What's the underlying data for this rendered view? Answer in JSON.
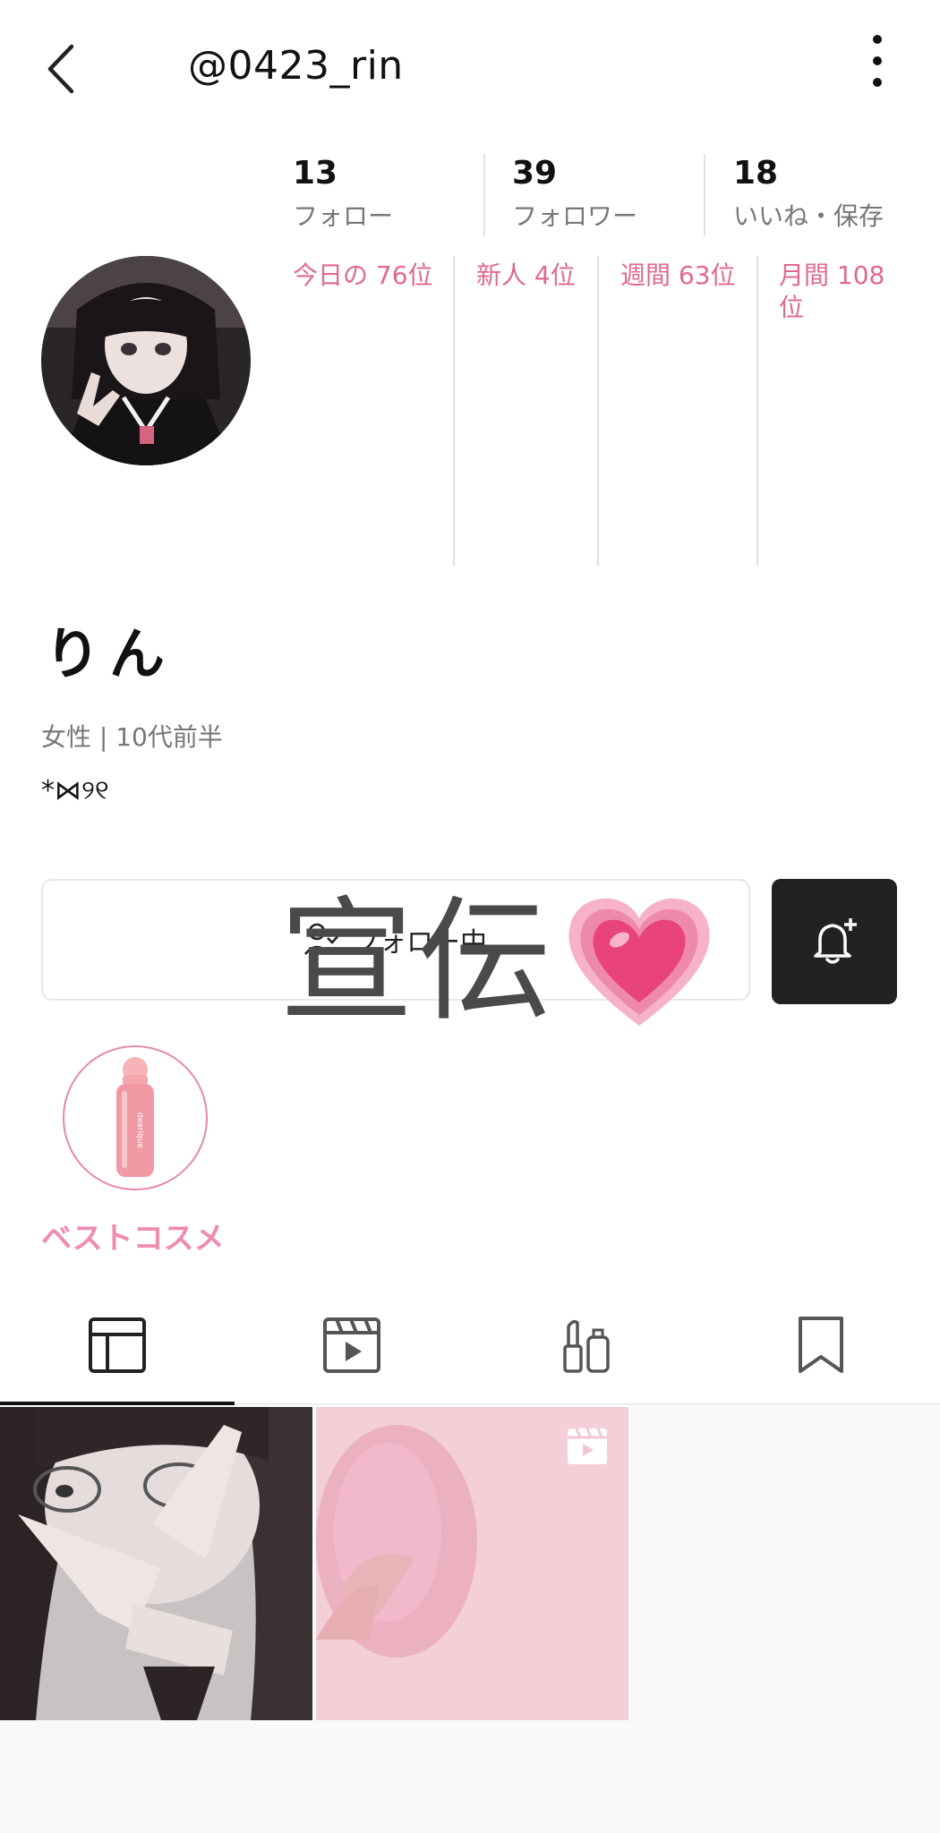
{
  "header": {
    "username": "@0423_rin"
  },
  "stats": [
    {
      "count": "13",
      "label": "フォロー"
    },
    {
      "count": "39",
      "label": "フォロワー"
    },
    {
      "count": "18",
      "label": "いいね・保存"
    }
  ],
  "rankings": [
    {
      "label": "今日の 76位"
    },
    {
      "label": "新人 4位"
    },
    {
      "label": "週間 63位"
    },
    {
      "label": "月間 108 位"
    }
  ],
  "profile": {
    "display_name": "りん",
    "meta": "女性 | 10代前半",
    "bio": "*⋈୨୧"
  },
  "actions": {
    "follow_label": "フォロー中"
  },
  "overlay": {
    "text": "宣伝"
  },
  "best_cosme": {
    "label": "ベストコスメ",
    "product_brand": "dearique"
  },
  "tabs": [
    {
      "icon": "grid-icon",
      "selected": true
    },
    {
      "icon": "video-icon",
      "selected": false
    },
    {
      "icon": "cosmetics-icon",
      "selected": false
    },
    {
      "icon": "bookmark-icon",
      "selected": false
    }
  ],
  "colors": {
    "rank_pink": "#e0698d",
    "best_cosme_pink": "#ef8bb0",
    "dark_button": "#222222"
  }
}
